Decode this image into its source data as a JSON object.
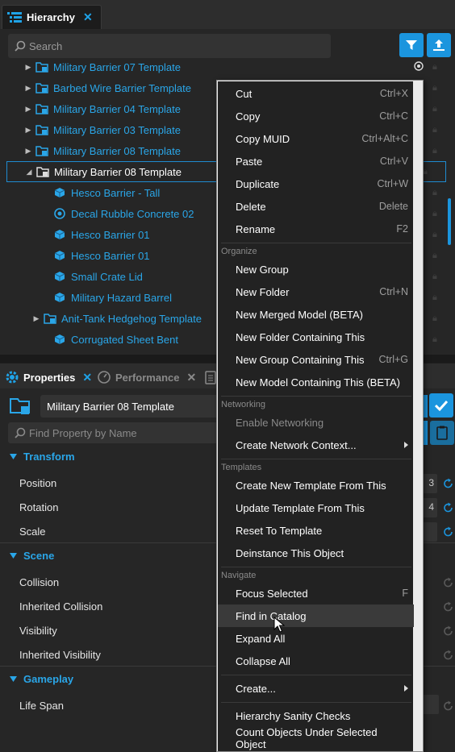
{
  "hierarchy": {
    "tab_title": "Hierarchy",
    "search_placeholder": "Search",
    "rows": [
      {
        "label": "Military Barrier 07 Template",
        "type": "template",
        "expand": "collapsed"
      },
      {
        "label": "Barbed Wire Barrier Template",
        "type": "template",
        "expand": "collapsed"
      },
      {
        "label": "Military Barrier 04 Template",
        "type": "template",
        "expand": "collapsed"
      },
      {
        "label": "Military Barrier 03 Template",
        "type": "template",
        "expand": "collapsed"
      },
      {
        "label": "Military Barrier 08 Template",
        "type": "template",
        "expand": "collapsed"
      },
      {
        "label": "Military Barrier 08 Template",
        "type": "template",
        "expand": "expanded",
        "selected": true
      },
      {
        "label": "Hesco Barrier - Tall",
        "type": "mesh"
      },
      {
        "label": "Decal Rubble Concrete 02",
        "type": "decal"
      },
      {
        "label": "Hesco Barrier 01",
        "type": "mesh"
      },
      {
        "label": "Hesco Barrier 01",
        "type": "mesh"
      },
      {
        "label": "Small Crate Lid",
        "type": "mesh"
      },
      {
        "label": "Military Hazard Barrel",
        "type": "mesh"
      },
      {
        "label": "Anit-Tank Hedgehog Template",
        "type": "template",
        "expand": "collapsed"
      },
      {
        "label": "Corrugated Sheet Bent",
        "type": "mesh"
      }
    ]
  },
  "properties": {
    "tabs": [
      {
        "label": "Properties",
        "active": true
      },
      {
        "label": "Performance",
        "active": false
      }
    ],
    "object_name": "Military Barrier 08 Template",
    "find_placeholder": "Find Property by Name",
    "sections": [
      {
        "title": "Transform",
        "rows": [
          "Position",
          "Rotation",
          "Scale"
        ]
      },
      {
        "title": "Scene",
        "rows": [
          "Collision",
          "Inherited Collision",
          "Visibility",
          "Inherited Visibility"
        ]
      },
      {
        "title": "Gameplay",
        "rows": [
          "Life Span"
        ]
      }
    ],
    "partial_values": [
      "3",
      "4"
    ]
  },
  "context_menu": {
    "groups": [
      {
        "category": "",
        "items": [
          {
            "label": "Cut",
            "shortcut": "Ctrl+X"
          },
          {
            "label": "Copy",
            "shortcut": "Ctrl+C"
          },
          {
            "label": "Copy MUID",
            "shortcut": "Ctrl+Alt+C"
          },
          {
            "label": "Paste",
            "shortcut": "Ctrl+V"
          },
          {
            "label": "Duplicate",
            "shortcut": "Ctrl+W"
          },
          {
            "label": "Delete",
            "shortcut": "Delete"
          },
          {
            "label": "Rename",
            "shortcut": "F2"
          }
        ]
      },
      {
        "category": "Organize",
        "items": [
          {
            "label": "New Group",
            "shortcut": ""
          },
          {
            "label": "New Folder",
            "shortcut": "Ctrl+N"
          },
          {
            "label": "New Merged Model (BETA)",
            "shortcut": ""
          },
          {
            "label": "New Folder Containing This",
            "shortcut": ""
          },
          {
            "label": "New Group Containing This",
            "shortcut": "Ctrl+G"
          },
          {
            "label": "New Model Containing This (BETA)",
            "shortcut": ""
          }
        ]
      },
      {
        "category": "Networking",
        "items": [
          {
            "label": "Enable Networking",
            "shortcut": "",
            "disabled": true
          },
          {
            "label": "Create Network Context...",
            "shortcut": "",
            "submenu": true
          }
        ]
      },
      {
        "category": "Templates",
        "items": [
          {
            "label": "Create New Template From This",
            "shortcut": ""
          },
          {
            "label": "Update Template From This",
            "shortcut": ""
          },
          {
            "label": "Reset To Template",
            "shortcut": ""
          },
          {
            "label": "Deinstance This Object",
            "shortcut": ""
          }
        ]
      },
      {
        "category": "Navigate",
        "items": [
          {
            "label": "Focus Selected",
            "shortcut": "F"
          },
          {
            "label": "Find in Catalog",
            "shortcut": "",
            "hover": true
          },
          {
            "label": "Expand All",
            "shortcut": ""
          },
          {
            "label": "Collapse All",
            "shortcut": ""
          }
        ]
      },
      {
        "category": "",
        "items": [
          {
            "label": "Create...",
            "shortcut": "",
            "submenu": true
          }
        ]
      },
      {
        "category": "",
        "items": [
          {
            "label": "Hierarchy Sanity Checks",
            "shortcut": ""
          },
          {
            "label": "Count Objects Under Selected Object",
            "shortcut": ""
          }
        ]
      }
    ]
  },
  "colors": {
    "accent": "#1b95de",
    "link_text": "#2aa6e8",
    "panel_bg": "#262626"
  }
}
